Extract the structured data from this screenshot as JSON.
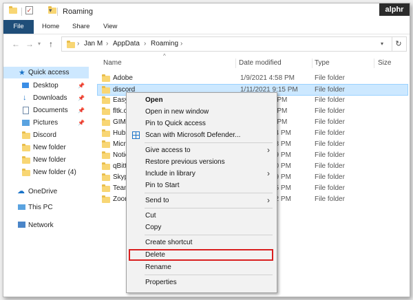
{
  "window": {
    "title": "Roaming",
    "brand": "alphr"
  },
  "ribbon": {
    "tabs": [
      "File",
      "Home",
      "Share",
      "View"
    ]
  },
  "address": {
    "crumbs": [
      "Jan M",
      "AppData",
      "Roaming"
    ]
  },
  "nav": {
    "quick_access": "Quick access",
    "items": [
      {
        "label": "Desktop",
        "icon": "desktop-icon",
        "pinned": true
      },
      {
        "label": "Downloads",
        "icon": "downloads-icon",
        "pinned": true
      },
      {
        "label": "Documents",
        "icon": "documents-icon",
        "pinned": true
      },
      {
        "label": "Pictures",
        "icon": "pictures-icon",
        "pinned": true
      },
      {
        "label": "Discord",
        "icon": "folder-icon",
        "pinned": false
      },
      {
        "label": "New folder",
        "icon": "folder-icon",
        "pinned": false
      },
      {
        "label": "New folder",
        "icon": "folder-icon",
        "pinned": false
      },
      {
        "label": "New folder (4)",
        "icon": "folder-icon",
        "pinned": false
      }
    ],
    "onedrive": "OneDrive",
    "thispc": "This PC",
    "network": "Network"
  },
  "columns": {
    "name": "Name",
    "date": "Date modified",
    "type": "Type",
    "size": "Size"
  },
  "files": [
    {
      "name": "Adobe",
      "date": "1/9/2021 4:58 PM",
      "type": "File folder"
    },
    {
      "name": "discord",
      "date": "1/11/2021 9:15 PM",
      "type": "File folder"
    },
    {
      "name": "EasyA",
      "date": "9 PM",
      "type": "File folder"
    },
    {
      "name": "fltk.o",
      "date": "9 PM",
      "type": "File folder"
    },
    {
      "name": "GIMP",
      "date": "9 PM",
      "type": "File folder"
    },
    {
      "name": "Hubs",
      "date": "24 PM",
      "type": "File folder"
    },
    {
      "name": "Micro",
      "date": "38 PM",
      "type": "File folder"
    },
    {
      "name": "Notic",
      "date": "19 PM",
      "type": "File folder"
    },
    {
      "name": "qBitt",
      "date": "20 PM",
      "type": "File folder"
    },
    {
      "name": "Skyp",
      "date": "19 PM",
      "type": "File folder"
    },
    {
      "name": "Team",
      "date": "25 PM",
      "type": "File folder"
    },
    {
      "name": "Zoor",
      "date": "32 PM",
      "type": "File folder"
    }
  ],
  "context_menu": {
    "open": "Open",
    "open_new_window": "Open in new window",
    "pin_quick": "Pin to Quick access",
    "scan": "Scan with Microsoft Defender...",
    "give_access": "Give access to",
    "restore": "Restore previous versions",
    "include_library": "Include in library",
    "pin_start": "Pin to Start",
    "send_to": "Send to",
    "cut": "Cut",
    "copy": "Copy",
    "create_shortcut": "Create shortcut",
    "delete": "Delete",
    "rename": "Rename",
    "properties": "Properties"
  },
  "colors": {
    "accent": "#1f4e79",
    "selection": "#cce8ff",
    "highlight_box": "#d91e1e",
    "folder": "#f8d674"
  }
}
